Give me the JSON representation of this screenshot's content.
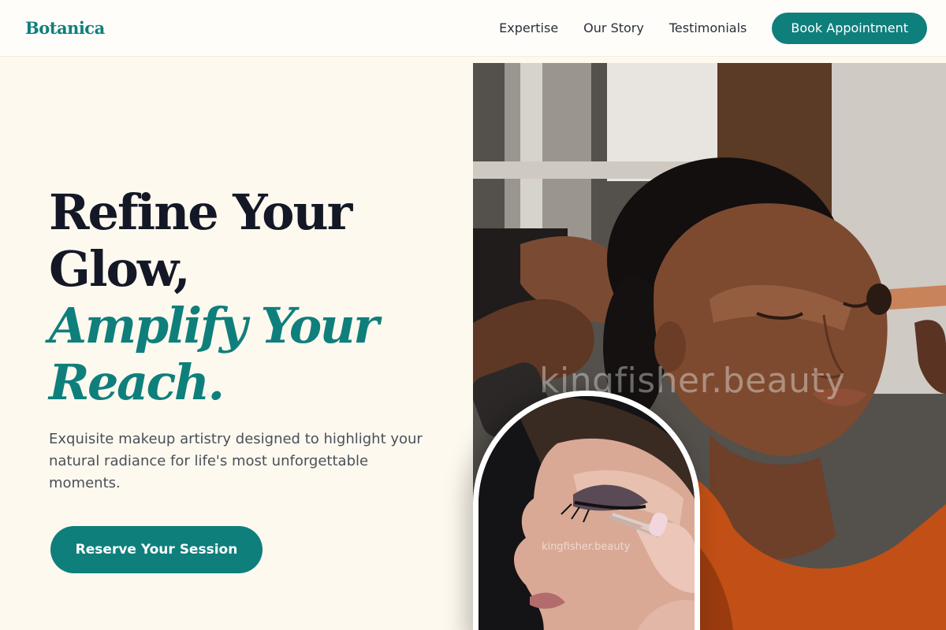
{
  "brand": {
    "name": "Botanica",
    "accent": "#0f7f7c"
  },
  "nav": {
    "items": [
      {
        "label": "Expertise"
      },
      {
        "label": "Our Story"
      },
      {
        "label": "Testimonials"
      }
    ],
    "book_label": "Book Appointment"
  },
  "hero": {
    "headline_line1": "Refine Your",
    "headline_line2": "Glow,",
    "headline_accent1": "Amplify Your",
    "headline_accent2": "Reach.",
    "subtitle": "Exquisite makeup artistry designed to highlight your natural radiance for life's most unforgettable moments.",
    "cta_label": "Reserve Your Session"
  },
  "images": {
    "main_watermark": "kingfisher.beauty",
    "inset_watermark": "kingfisher.beauty"
  }
}
